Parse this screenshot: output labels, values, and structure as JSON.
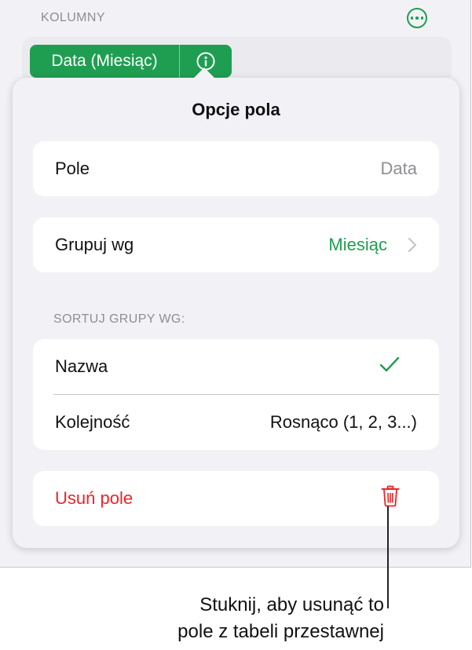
{
  "columns": {
    "header": "KOLUMNY",
    "field_chip_label": "Data (Miesiąc)"
  },
  "popover": {
    "title": "Opcje pola",
    "field_row": {
      "label": "Pole",
      "value": "Data"
    },
    "group_row": {
      "label": "Grupuj wg",
      "value": "Miesiąc"
    },
    "sort_header": "SORTUJ GRUPY WG:",
    "sort_rows": [
      {
        "label": "Nazwa",
        "checked": true
      },
      {
        "label": "Kolejność",
        "value": "Rosnąco (1, 2, 3...)"
      }
    ],
    "delete_row": {
      "label": "Usuń pole"
    }
  },
  "callout": {
    "line1": "Stuknij, aby usunąć to",
    "line2": "pole z tabeli przestawnej"
  },
  "colors": {
    "accent_green": "#1e9e50",
    "destructive_red": "#e8262b"
  },
  "icons": [
    "more-options-icon",
    "info-icon",
    "chevron-right-icon",
    "checkmark-icon",
    "trash-icon"
  ]
}
